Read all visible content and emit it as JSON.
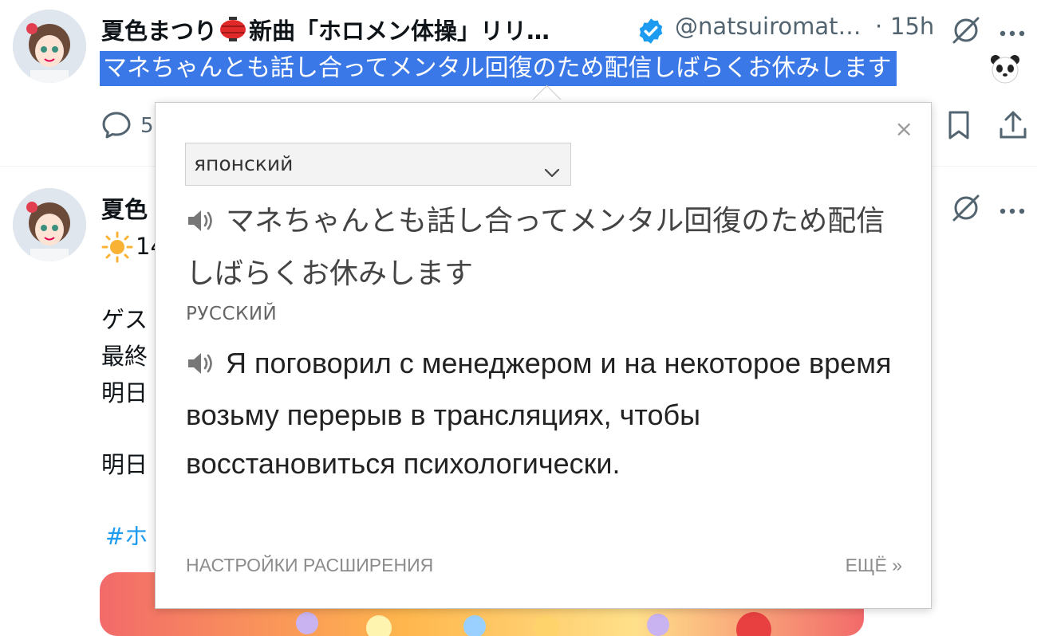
{
  "tweet1": {
    "display_name": "夏色まつり",
    "display_name_rest": "新曲「ホロメン体操」リリ…",
    "handle": "@natsuiromat…",
    "separator": "·",
    "time": "15h",
    "selected_text": "マネちゃんとも話し合ってメンタル回復のため配信しばらくお休みします",
    "reply_count": "5"
  },
  "tweet2": {
    "display_name": "夏色",
    "line_prefix": "14",
    "lines": [
      "ゲス",
      "最終",
      "明日",
      "明日"
    ],
    "hashtag": "#ホ"
  },
  "popup": {
    "source_lang": "японский",
    "source_text": "マネちゃんとも話し合ってメンタル回復のため配信しばらくお休みします",
    "target_lang": "РУССКИЙ",
    "target_text": "Я поговорил с менеджером и на некоторое время возьму перерыв в трансляциях, чтобы восстановиться психологически.",
    "footer_settings": "НАСТРОЙКИ РАСШИРЕНИЯ",
    "footer_more": "ЕЩЁ »",
    "close": "×"
  },
  "icons": {
    "verified": "verified-badge-icon",
    "grok": "grok-icon",
    "more": "more-icon",
    "reply": "reply-icon",
    "bookmark": "bookmark-icon",
    "share": "share-icon",
    "speaker": "speaker-icon",
    "chevron": "chevron-down-icon"
  },
  "colors": {
    "selection": "#3b78e7",
    "verified": "#1d9bf0",
    "hashtag": "#1d9bf0",
    "muted": "#536471"
  }
}
